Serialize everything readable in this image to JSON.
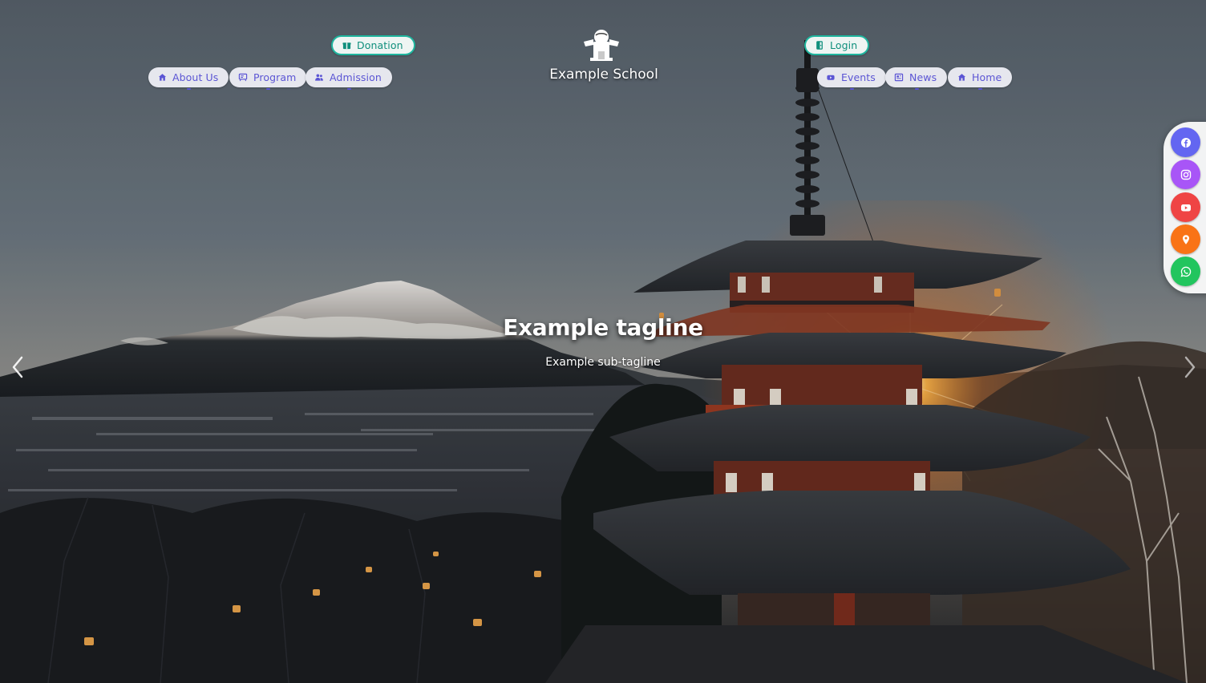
{
  "header": {
    "brand_name": "Example School",
    "logo_icon": "school-logo-icon",
    "nav_left": [
      {
        "label": "About Us",
        "icon": "home-icon"
      },
      {
        "label": "Program",
        "icon": "board-icon"
      },
      {
        "label": "Admission",
        "icon": "users-icon"
      }
    ],
    "nav_right": [
      {
        "label": "Events",
        "icon": "video-icon"
      },
      {
        "label": "News",
        "icon": "newspaper-icon"
      },
      {
        "label": "Home",
        "icon": "home-icon"
      }
    ],
    "donation_label": "Donation",
    "login_label": "Login"
  },
  "hero": {
    "tagline": "Example tagline",
    "subtagline": "Example sub-tagline"
  },
  "carousel": {
    "prev_icon": "chevron-left-icon",
    "next_icon": "chevron-right-icon"
  },
  "social": [
    {
      "name": "facebook",
      "icon": "facebook-icon",
      "color": "#6366f1"
    },
    {
      "name": "instagram",
      "icon": "instagram-icon",
      "color": "#a855f7"
    },
    {
      "name": "youtube",
      "icon": "youtube-icon",
      "color": "#ef4444"
    },
    {
      "name": "location",
      "icon": "location-pin-icon",
      "color": "#f97316"
    },
    {
      "name": "whatsapp",
      "icon": "whatsapp-icon",
      "color": "#22c55e"
    }
  ],
  "colors": {
    "nav_pill_bg": "#e6e7ee",
    "nav_text": "#5b55d4",
    "cta_border": "#1fb59e",
    "cta_text": "#0f8f7c"
  }
}
